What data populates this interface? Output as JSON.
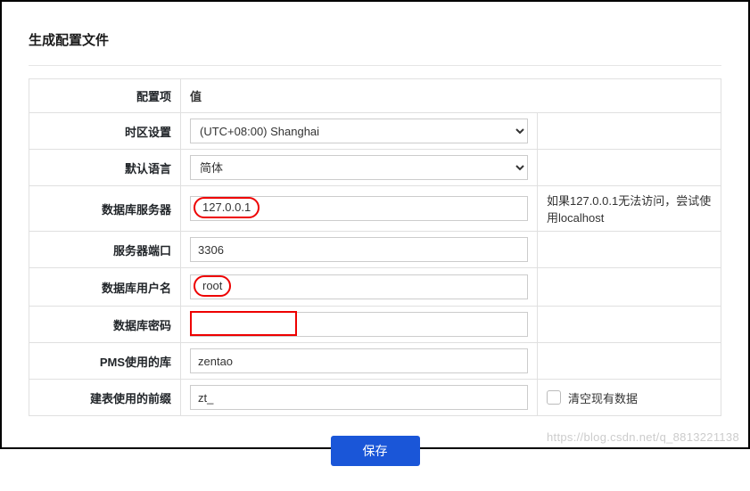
{
  "title": "生成配置文件",
  "headers": {
    "label": "配置项",
    "value": "值"
  },
  "rows": {
    "timezone": {
      "label": "时区设置",
      "value": "(UTC+08:00) Shanghai"
    },
    "language": {
      "label": "默认语言",
      "value": "简体"
    },
    "dbserver": {
      "label": "数据库服务器",
      "value": "127.0.0.1",
      "hint": "如果127.0.0.1无法访问，尝试使用localhost"
    },
    "port": {
      "label": "服务器端口",
      "value": "3306"
    },
    "dbuser": {
      "label": "数据库用户名",
      "value": "root"
    },
    "dbpassword": {
      "label": "数据库密码",
      "value": ""
    },
    "pmsdb": {
      "label": "PMS使用的库",
      "value": "zentao"
    },
    "prefix": {
      "label": "建表使用的前缀",
      "value": "zt_",
      "checkbox_label": "清空现有数据"
    }
  },
  "save_button": "保存",
  "watermark": "https://blog.csdn.net/q_8813221138"
}
